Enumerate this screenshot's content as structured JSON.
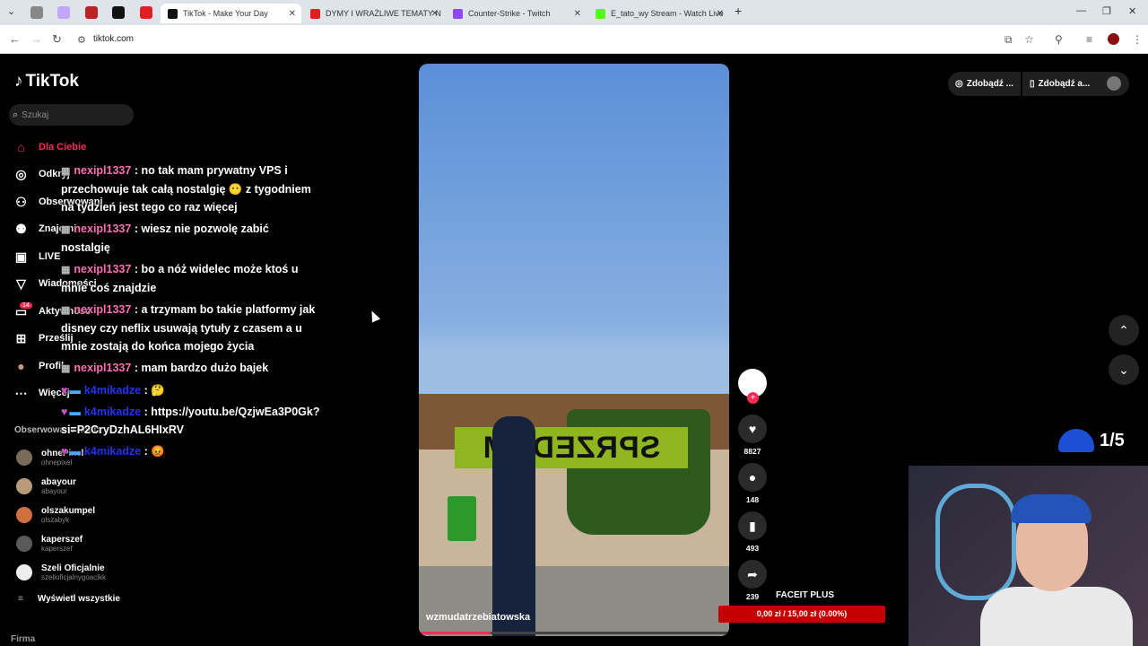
{
  "browser": {
    "tabs": [
      {
        "title": "TikTok - Make Your Day",
        "active": true
      },
      {
        "title": "DYMY I WRAŻLIWE TEMATY N"
      },
      {
        "title": "Counter-Strike - Twitch"
      },
      {
        "title": "E_tato_wy Stream - Watch Live"
      }
    ],
    "url": "tiktok.com"
  },
  "sidebar": {
    "logo": "TikTok",
    "search_placeholder": "Szukaj",
    "nav": [
      {
        "label": "Dla Ciebie",
        "icon": "home-icon"
      },
      {
        "label": "Odkryj",
        "icon": "compass-icon"
      },
      {
        "label": "Obserwowani",
        "icon": "user-follow-icon"
      },
      {
        "label": "Znajomi",
        "icon": "friends-icon"
      },
      {
        "label": "LIVE",
        "icon": "live-icon"
      },
      {
        "label": "Wiadomości",
        "icon": "send-icon"
      },
      {
        "label": "Aktywność",
        "icon": "inbox-icon"
      },
      {
        "label": "Prześlij",
        "icon": "upload-icon"
      },
      {
        "label": "Profil",
        "icon": "profile-icon"
      },
      {
        "label": "Więcej",
        "icon": "more-icon"
      }
    ],
    "activity_badge": "14",
    "following_header": "Obserwowane konta",
    "accounts": [
      {
        "name": "ohnePixel",
        "handle": "ohnepixel"
      },
      {
        "name": "abayour",
        "handle": "abayour"
      },
      {
        "name": "olszakumpel",
        "handle": "olszabyk"
      },
      {
        "name": "kaperszef",
        "handle": "kaperszef"
      },
      {
        "name": "Szeli Oficjalnie",
        "handle": "szelioficjalnygoaclkk"
      }
    ],
    "see_all": "Wyświetl wszystkie",
    "footer": "Firma"
  },
  "chat": [
    {
      "user": "nexipl1337",
      "text": ": no tak mam prywatny VPS i przechowuje tak całą nostalgię 😶 z tygodniem na tydzień jest tego co raz więcej"
    },
    {
      "user": "nexipl1337",
      "text": ": wiesz nie pozwolę zabić nostalgię"
    },
    {
      "user": "nexipl1337",
      "text": ": bo a nóż widelec może ktoś u mnie coś znajdzie"
    },
    {
      "user": "nexipl1337",
      "text": ": a trzymam bo takie platformy jak disney czy neflix usuwają tytuły z czasem a u mnie zostają do końca mojego życia"
    },
    {
      "user": "nexipl1337",
      "text": ": mam bardzo dużo bajek"
    },
    {
      "user": "k4mikadze",
      "text": ": 🤔"
    },
    {
      "user": "k4mikadze",
      "text": ": https://youtu.be/QzjwEa3P0Gk?si=P2CryDzhAL6HIxRV"
    },
    {
      "user": "k4mikadze",
      "text": ": 😡"
    }
  ],
  "video": {
    "username": "wzmudatrzebiatowska",
    "sign_text": "SPRZEDAM",
    "progress": 0.23
  },
  "actions": {
    "likes": "8827",
    "comments": "148",
    "saves": "493",
    "shares": "239"
  },
  "top_buttons": [
    "Zdobądź ...",
    "Zdobądź a..."
  ],
  "overlay": {
    "counter": "1/5",
    "faceit_title": "FACEIT PLUS",
    "faceit_bar": "0,00 zł / 15,00 zł (0.00%)"
  }
}
